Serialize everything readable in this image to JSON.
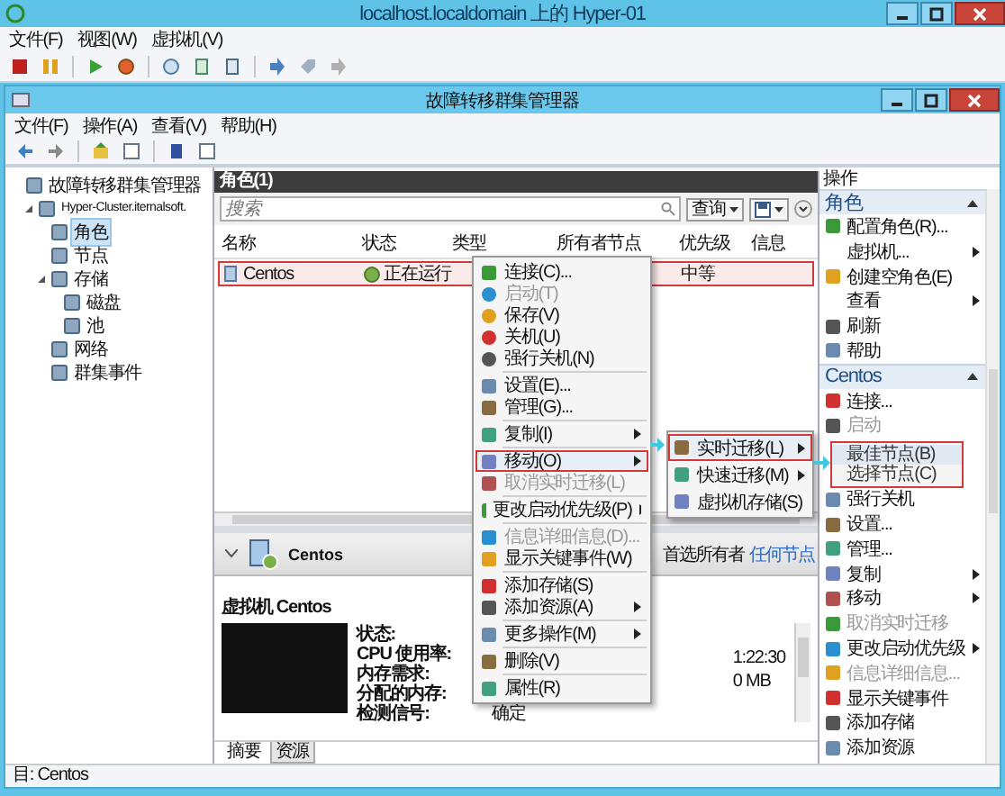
{
  "hyperv_window": {
    "title": "localhost.localdomain 上的 Hyper-01",
    "menu": [
      "文件(F)",
      "视图(W)",
      "虚拟机(V)"
    ]
  },
  "cluster_window": {
    "title": "故障转移群集管理器",
    "menu": [
      "文件(F)",
      "操作(A)",
      "查看(V)",
      "帮助(H)"
    ]
  },
  "tree": [
    {
      "label": "故障转移群集管理器",
      "selected": false,
      "children": [
        {
          "label": "Hyper-Cluster.iternalsoft.",
          "expanded": true,
          "selected": false,
          "children": [
            {
              "label": "角色",
              "selected": true
            },
            {
              "label": "节点",
              "selected": false
            },
            {
              "label": "存储",
              "expanded": true,
              "selected": false,
              "children": [
                {
                  "label": "磁盘",
                  "selected": false
                },
                {
                  "label": "池",
                  "selected": false
                }
              ]
            },
            {
              "label": "网络",
              "selected": false
            },
            {
              "label": "群集事件",
              "selected": false
            }
          ]
        }
      ]
    }
  ],
  "roles": {
    "title": "角色(1)",
    "search_placeholder": "搜索",
    "query_button": "查询",
    "columns": [
      "名称",
      "状态",
      "类型",
      "所有者节点",
      "优先级",
      "信息"
    ],
    "rows": [
      {
        "name": "Centos",
        "status": "正在运行",
        "priority": "中等",
        "selected": true
      }
    ]
  },
  "details": {
    "name": "Centos",
    "preferred_owner_label": "首选所有者",
    "preferred_owner": "任何节点",
    "heading": "虚拟机 Centos",
    "fields": [
      {
        "label": "状态:"
      },
      {
        "label": "CPU 使用率:"
      },
      {
        "label": "内存需求:"
      },
      {
        "label": "分配的内存:"
      },
      {
        "label": "检测信号:",
        "value": "确定"
      }
    ],
    "right_values": [
      "1:22:30",
      "0 MB"
    ],
    "tabs": [
      {
        "label": "摘要",
        "selected": true
      },
      {
        "label": "资源",
        "selected": false
      }
    ]
  },
  "status_bar": "目: Centos",
  "actions": {
    "title": "操作",
    "sections": [
      {
        "title": "角色",
        "expanded": true,
        "items": [
          {
            "label": "配置角色(R)...",
            "icon": true,
            "submenu": false,
            "disabled": false
          },
          {
            "label": "虚拟机...",
            "icon": false,
            "submenu": true,
            "disabled": false
          },
          {
            "label": "创建空角色(E)",
            "icon": true,
            "submenu": false,
            "disabled": false
          },
          {
            "label": "查看",
            "icon": false,
            "submenu": true,
            "disabled": false
          },
          {
            "label": "刷新",
            "icon": true,
            "submenu": false,
            "disabled": false
          },
          {
            "label": "帮助",
            "icon": true,
            "submenu": false,
            "disabled": false
          }
        ]
      },
      {
        "title": "Centos",
        "expanded": true,
        "items": [
          {
            "label": "连接...",
            "icon": true,
            "submenu": false,
            "disabled": false
          },
          {
            "label": "启动",
            "icon": true,
            "submenu": false,
            "disabled": true
          },
          {
            "label": "强行关机",
            "icon": true,
            "submenu": false,
            "disabled": false,
            "gap_before": true
          },
          {
            "label": "设置...",
            "icon": true,
            "submenu": false,
            "disabled": false
          },
          {
            "label": "管理...",
            "icon": true,
            "submenu": false,
            "disabled": false
          },
          {
            "label": "复制",
            "icon": true,
            "submenu": true,
            "disabled": false
          },
          {
            "label": "移动",
            "icon": true,
            "submenu": true,
            "disabled": false
          },
          {
            "label": "取消实时迁移",
            "icon": true,
            "submenu": false,
            "disabled": true
          },
          {
            "label": "更改启动优先级",
            "icon": true,
            "submenu": true,
            "disabled": false
          },
          {
            "label": "信息详细信息...",
            "icon": true,
            "submenu": false,
            "disabled": true
          },
          {
            "label": "显示关键事件",
            "icon": true,
            "submenu": false,
            "disabled": false
          },
          {
            "label": "添加存储",
            "icon": true,
            "submenu": false,
            "disabled": false
          },
          {
            "label": "添加资源",
            "icon": true,
            "submenu": false,
            "disabled": false
          }
        ]
      }
    ]
  },
  "context_menu": [
    [
      {
        "label": "连接(C)...",
        "disabled": false,
        "submenu": false,
        "selected": false
      },
      {
        "label": "启动(T)",
        "disabled": true,
        "submenu": false,
        "selected": false
      },
      {
        "label": "保存(V)",
        "disabled": false,
        "submenu": false,
        "selected": false
      },
      {
        "label": "关机(U)",
        "disabled": false,
        "submenu": false,
        "selected": false
      },
      {
        "label": "强行关机(N)",
        "disabled": false,
        "submenu": false,
        "selected": false
      }
    ],
    [
      {
        "label": "设置(E)...",
        "disabled": false,
        "submenu": false,
        "selected": false
      },
      {
        "label": "管理(G)...",
        "disabled": false,
        "submenu": false,
        "selected": false
      }
    ],
    [
      {
        "label": "复制(I)",
        "disabled": false,
        "submenu": true,
        "selected": false
      }
    ],
    [
      {
        "label": "移动(O)",
        "disabled": false,
        "submenu": true,
        "selected": true
      },
      {
        "label": "取消实时迁移(L)",
        "disabled": true,
        "submenu": false,
        "selected": false
      }
    ],
    [
      {
        "label": "更改启动优先级(P)",
        "disabled": false,
        "submenu": true,
        "selected": false
      }
    ],
    [
      {
        "label": "信息详细信息(D)...",
        "disabled": true,
        "submenu": false,
        "selected": false
      },
      {
        "label": "显示关键事件(W)",
        "disabled": false,
        "submenu": false,
        "selected": false
      }
    ],
    [
      {
        "label": "添加存储(S)",
        "disabled": false,
        "submenu": false,
        "selected": false
      },
      {
        "label": "添加资源(A)",
        "disabled": false,
        "submenu": true,
        "selected": false
      }
    ],
    [
      {
        "label": "更多操作(M)",
        "disabled": false,
        "submenu": true,
        "selected": false
      }
    ],
    [
      {
        "label": "删除(V)",
        "disabled": false,
        "submenu": false,
        "selected": false
      }
    ],
    [
      {
        "label": "属性(R)",
        "disabled": false,
        "submenu": false,
        "selected": false
      }
    ]
  ],
  "move_submenu": [
    {
      "label": "实时迁移(L)",
      "submenu": true,
      "selected": true
    },
    {
      "label": "快速迁移(M)",
      "submenu": true,
      "selected": false
    },
    {
      "label": "虚拟机存储(S)",
      "submenu": false,
      "selected": false
    }
  ],
  "live_migration_submenu": [
    {
      "label": "最佳节点(B)",
      "selected": true
    },
    {
      "label": "选择节点(C)",
      "selected": false
    }
  ]
}
